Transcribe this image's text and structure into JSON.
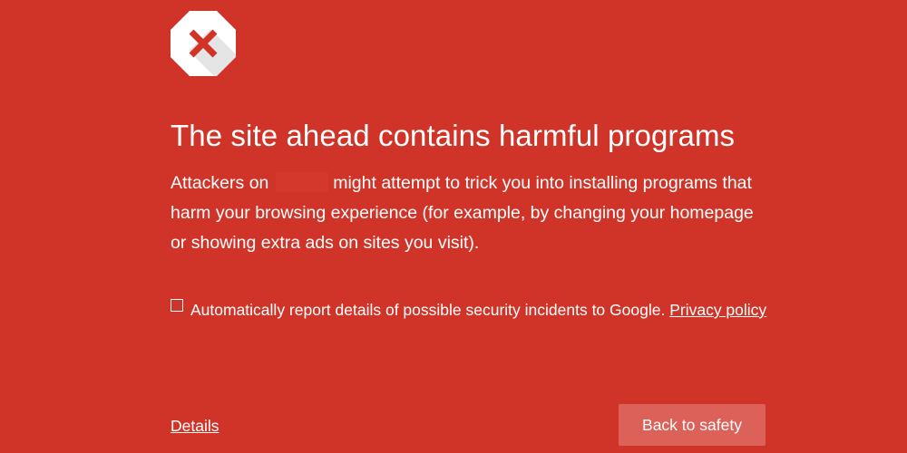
{
  "icon": "error-octagon-icon",
  "colors": {
    "background": "#d03428",
    "icon_cross": "#d03428",
    "button_bg": "#dc6259",
    "text": "#ffffff"
  },
  "heading": "The site ahead contains harmful programs",
  "description": {
    "before_domain": "Attackers on",
    "after_domain": "might attempt to trick you into installing programs that harm your browsing experience (for example, by changing your homepage or showing extra ads on sites you visit)."
  },
  "report": {
    "checked": false,
    "text": "Automatically report details of possible security incidents to Google.",
    "link": "Privacy policy"
  },
  "footer": {
    "details_link": "Details",
    "back_button": "Back to safety"
  }
}
